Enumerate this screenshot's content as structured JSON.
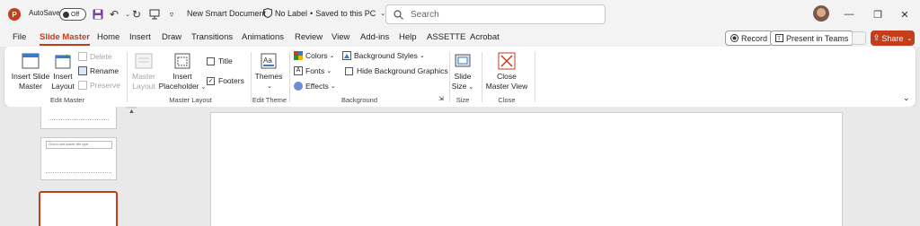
{
  "titlebar": {
    "app_icon": "P",
    "autosave_label": "AutoSave",
    "autosave_state": "Off",
    "doc_title": "New Smart Document",
    "sensitivity": "No Label",
    "save_status": "Saved to this PC",
    "search_placeholder": "Search",
    "icons": [
      "powerpoint-icon",
      "save-icon",
      "undo-icon",
      "redo-icon",
      "present-icon",
      "customize-qat-icon",
      "shield-icon",
      "search-icon",
      "minimize-icon",
      "restore-icon",
      "close-icon"
    ]
  },
  "tabs": [
    "File",
    "Slide Master",
    "Home",
    "Insert",
    "Draw",
    "Transitions",
    "Animations",
    "Review",
    "View",
    "Add-ins",
    "Help",
    "ASSETTE",
    "Acrobat"
  ],
  "active_tab": "Slide Master",
  "right_buttons": {
    "record": "Record",
    "present_teams": "Present in Teams",
    "share": "Share"
  },
  "ribbon": {
    "edit_master": {
      "label": "Edit Master",
      "insert_slide_master": [
        "Insert Slide",
        "Master"
      ],
      "insert_layout": [
        "Insert",
        "Layout"
      ],
      "delete": "Delete",
      "rename": "Rename",
      "preserve": "Preserve"
    },
    "master_layout": {
      "label": "Master Layout",
      "master_layout": [
        "Master",
        "Layout"
      ],
      "insert_placeholder": [
        "Insert",
        "Placeholder"
      ],
      "title": "Title",
      "footers": "Footers",
      "title_checked": false,
      "footers_checked": true
    },
    "edit_theme": {
      "label": "Edit Theme",
      "themes": "Themes"
    },
    "background": {
      "label": "Background",
      "colors": "Colors",
      "fonts": "Fonts",
      "effects": "Effects",
      "background_styles": "Background Styles",
      "hide_background_graphics": "Hide Background Graphics",
      "hide_bg_checked": false
    },
    "size": {
      "label": "Size",
      "slide_size": [
        "Slide",
        "Size"
      ]
    },
    "close": {
      "label": "Close",
      "close_master_view": [
        "Close",
        "Master View"
      ]
    }
  },
  "thumbnails": {
    "thumb2_text": "Click to edit Master title style"
  },
  "colors": {
    "accent": "#c43e1c",
    "titlebar_bg": "#f3f3f3",
    "workspace_bg": "#e9e9e9"
  }
}
